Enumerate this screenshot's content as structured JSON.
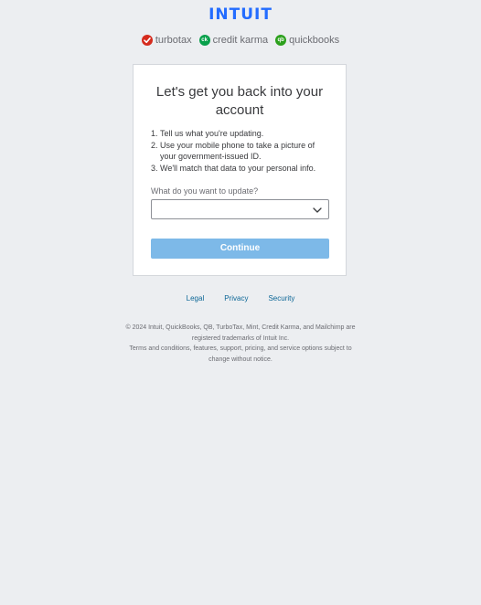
{
  "header": {
    "logo_text": "INTUIT"
  },
  "brands": [
    {
      "name": "turbotax",
      "color": "#d52b1e"
    },
    {
      "name": "credit karma",
      "color": "#08a04b"
    },
    {
      "name": "quickbooks",
      "color": "#2ca01c"
    }
  ],
  "card": {
    "title_line1": "Let's get you back into your",
    "title_line2": "account",
    "steps": [
      {
        "num": "1.",
        "lines": [
          "Tell us what you're updating."
        ]
      },
      {
        "num": "2.",
        "lines": [
          "Use your mobile phone to take a picture of",
          "your government-issued ID."
        ]
      },
      {
        "num": "3.",
        "lines": [
          "We'll match that data to your personal info."
        ]
      }
    ],
    "field_label": "What do you want to update?",
    "select_value": "",
    "continue_label": "Continue",
    "continue_color": "#7db9e8"
  },
  "footer": {
    "links": [
      "Legal",
      "Privacy",
      "Security"
    ],
    "copyright_line1": "© 2024 Intuit, QuickBooks, QB, TurboTax, Mint, Credit Karma, and Mailchimp are",
    "copyright_line2": "registered trademarks of Intuit Inc.",
    "terms_line1": "Terms and conditions, features, support, pricing, and service options subject to",
    "terms_line2": "change without notice."
  }
}
